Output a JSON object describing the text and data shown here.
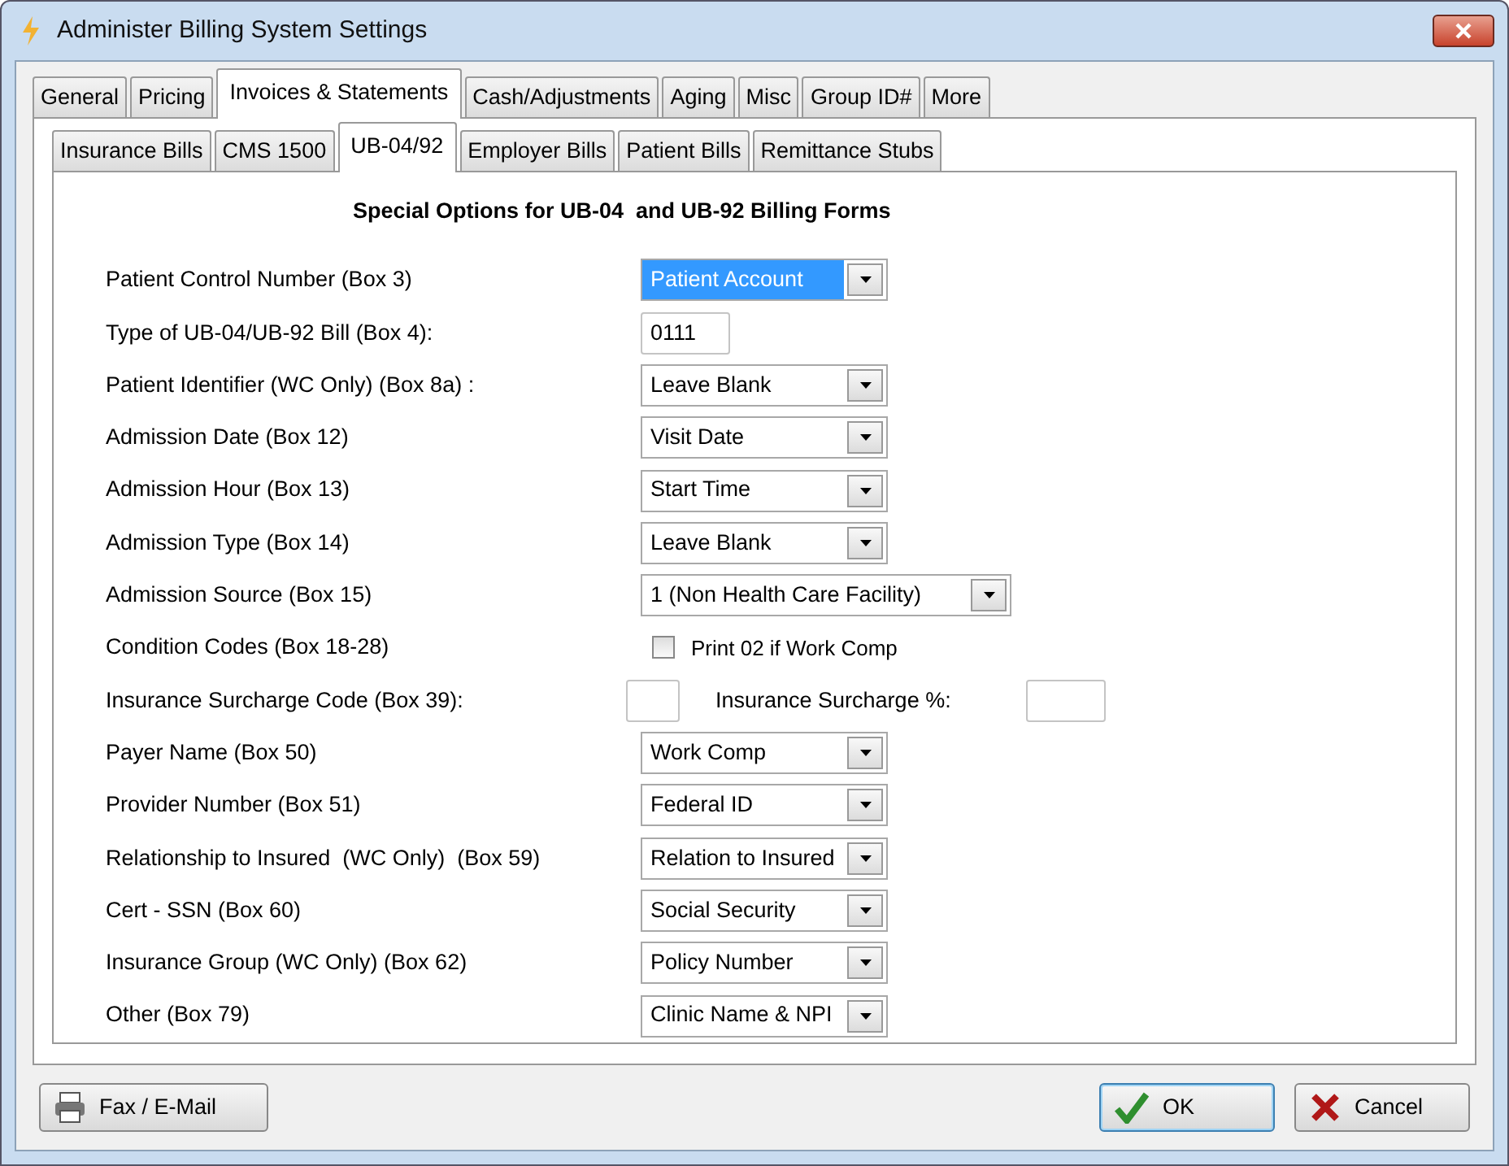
{
  "window": {
    "title": "Administer Billing System Settings"
  },
  "top_tabs": [
    {
      "label": "General",
      "selected": false
    },
    {
      "label": "Pricing",
      "selected": false
    },
    {
      "label": "Invoices & Statements",
      "selected": true
    },
    {
      "label": "Cash/Adjustments",
      "selected": false
    },
    {
      "label": "Aging",
      "selected": false
    },
    {
      "label": "Misc",
      "selected": false
    },
    {
      "label": "Group ID#",
      "selected": false
    },
    {
      "label": "More",
      "selected": false
    }
  ],
  "sub_tabs": [
    {
      "label": "Insurance Bills",
      "selected": false
    },
    {
      "label": "CMS 1500",
      "selected": false
    },
    {
      "label": "UB-04/92",
      "selected": true
    },
    {
      "label": "Employer Bills",
      "selected": false
    },
    {
      "label": "Patient Bills",
      "selected": false
    },
    {
      "label": "Remittance Stubs",
      "selected": false
    }
  ],
  "heading": "Special Options for UB-04  and UB-92 Billing Forms",
  "rows": [
    {
      "label": "Patient Control Number (Box 3)",
      "kind": "select",
      "value": "Patient Account",
      "focused": true
    },
    {
      "label": "Type of UB-04/UB-92 Bill (Box 4):",
      "kind": "text",
      "value": "0111"
    },
    {
      "label": "Patient Identifier (WC Only) (Box 8a) :",
      "kind": "select",
      "value": "Leave Blank",
      "focused": false
    },
    {
      "label": "Admission Date (Box 12)",
      "kind": "select",
      "value": "Visit Date",
      "focused": false
    },
    {
      "label": "Admission Hour (Box 13)",
      "kind": "select",
      "value": "Start Time",
      "focused": false
    },
    {
      "label": "Admission Type (Box 14)",
      "kind": "select",
      "value": "Leave Blank",
      "focused": false
    },
    {
      "label": "Admission Source (Box 15)",
      "kind": "wideselect",
      "value": "1 (Non Health Care Facility)",
      "focused": false
    },
    {
      "label": "Condition Codes (Box 18-28)",
      "kind": "checkbox",
      "option": "Print 02 if Work Comp",
      "checked": false
    },
    {
      "label": "Insurance Surcharge Code (Box 39):",
      "kind": "pair",
      "second_label": "Insurance Surcharge %:"
    },
    {
      "label": "Payer Name (Box 50)",
      "kind": "select",
      "value": "Work Comp",
      "focused": false
    },
    {
      "label": "Provider Number (Box 51)",
      "kind": "select",
      "value": "Federal ID",
      "focused": false
    },
    {
      "label": "Relationship to Insured  (WC Only)  (Box 59)",
      "kind": "select",
      "value": "Relation to Insured",
      "focused": false
    },
    {
      "label": "Cert - SSN (Box 60)",
      "kind": "select",
      "value": "Social Security",
      "focused": false
    },
    {
      "label": "Insurance Group (WC Only) (Box 62)",
      "kind": "select",
      "value": "Policy Number",
      "focused": false
    },
    {
      "label": "Other (Box 79)",
      "kind": "select",
      "value": "Clinic Name & NPI",
      "focused": false
    }
  ],
  "buttons": [
    {
      "label": "Fax / E-Mail",
      "kind": "fax",
      "default": false
    },
    {
      "label": "OK",
      "kind": "ok",
      "default": true
    },
    {
      "label": "Cancel",
      "kind": "cancel",
      "default": false
    }
  ]
}
